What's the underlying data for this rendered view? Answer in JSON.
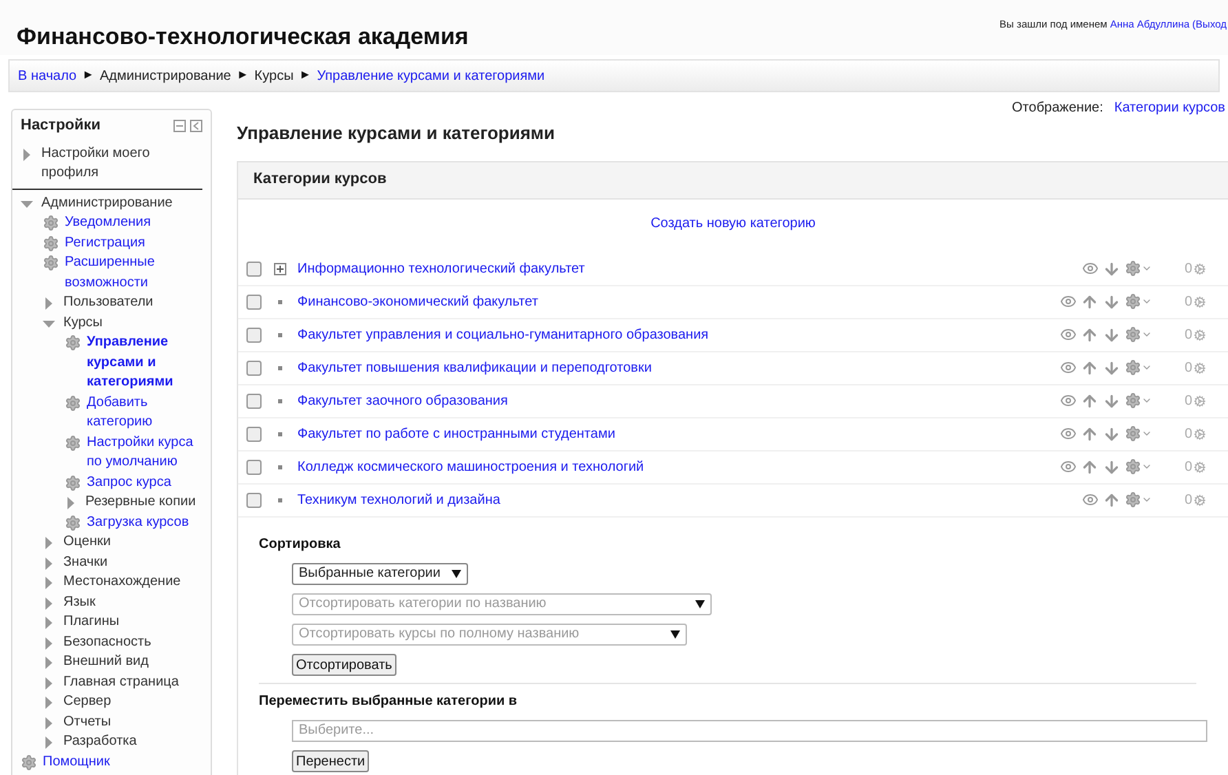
{
  "site": {
    "title": "Финансово-технологическая академия",
    "login": {
      "prefix": "Вы зашли под именем",
      "user": "Анна Абдуллина",
      "logout": "(Выход"
    }
  },
  "breadcrumb": [
    {
      "label": "В начало",
      "kind": "link"
    },
    {
      "label": "►",
      "kind": "separator"
    },
    {
      "label": "Администрирование",
      "kind": "text"
    },
    {
      "label": "►",
      "kind": "separator"
    },
    {
      "label": "Курсы",
      "kind": "text"
    },
    {
      "label": "►",
      "kind": "separator"
    },
    {
      "label": "Управление курсами и категориями",
      "kind": "link"
    }
  ],
  "sidebar": {
    "title": "Настройки",
    "items": [
      {
        "kind": "branch",
        "label": "Настройки моего профиля",
        "expanded": false
      },
      {
        "kind": "divider"
      },
      {
        "kind": "branch",
        "label": "Администрирование",
        "expanded": true,
        "children": [
          {
            "kind": "leaf",
            "label": "Уведомления",
            "selected": false
          },
          {
            "kind": "leaf",
            "label": "Регистрация",
            "selected": false
          },
          {
            "kind": "leaf",
            "label": "Расширенные возможности",
            "selected": false
          },
          {
            "kind": "branch",
            "label": "Пользователи",
            "expanded": false
          },
          {
            "kind": "branch",
            "label": "Курсы",
            "expanded": true,
            "children": [
              {
                "kind": "leaf",
                "label": "Управление курсами и категориями",
                "selected": true
              },
              {
                "kind": "leaf",
                "label": "Добавить категорию",
                "selected": false
              },
              {
                "kind": "leaf",
                "label": "Настройки курса по умолчанию",
                "selected": false
              },
              {
                "kind": "leaf",
                "label": "Запрос курса",
                "selected": false
              },
              {
                "kind": "branch",
                "label": "Резервные копии",
                "expanded": false
              },
              {
                "kind": "leaf",
                "label": "Загрузка курсов",
                "selected": false
              }
            ]
          },
          {
            "kind": "branch",
            "label": "Оценки",
            "expanded": false
          },
          {
            "kind": "branch",
            "label": "Значки",
            "expanded": false
          },
          {
            "kind": "branch",
            "label": "Местонахождение",
            "expanded": false
          },
          {
            "kind": "branch",
            "label": "Язык",
            "expanded": false
          },
          {
            "kind": "branch",
            "label": "Плагины",
            "expanded": false
          },
          {
            "kind": "branch",
            "label": "Безопасность",
            "expanded": false
          },
          {
            "kind": "branch",
            "label": "Внешний вид",
            "expanded": false
          },
          {
            "kind": "branch",
            "label": "Главная страница",
            "expanded": false
          },
          {
            "kind": "branch",
            "label": "Сервер",
            "expanded": false
          },
          {
            "kind": "branch",
            "label": "Отчеты",
            "expanded": false
          },
          {
            "kind": "branch",
            "label": "Разработка",
            "expanded": false
          }
        ]
      },
      {
        "kind": "leaf",
        "label": "Помощник",
        "selected": false
      }
    ]
  },
  "main": {
    "heading": "Управление курсами и категориями",
    "view_label": "Отображение:",
    "view_value": "Категории курсов",
    "panel_title": "Категории курсов",
    "create_link": "Создать новую категорию",
    "categories": [
      {
        "name": "Информационно технологический факультет",
        "kind": "expandable",
        "checked": false,
        "can_move_up": false,
        "can_move_down": true,
        "count": "0"
      },
      {
        "name": "Финансово-экономический факультет",
        "kind": "leaf",
        "checked": false,
        "can_move_up": true,
        "can_move_down": true,
        "count": "0"
      },
      {
        "name": "Факультет управления и социально-гуманитарного образования",
        "kind": "leaf",
        "checked": false,
        "can_move_up": true,
        "can_move_down": true,
        "count": "0"
      },
      {
        "name": "Факультет повышения квалификации и переподготовки",
        "kind": "leaf",
        "checked": false,
        "can_move_up": true,
        "can_move_down": true,
        "count": "0"
      },
      {
        "name": "Факультет заочного образования",
        "kind": "leaf",
        "checked": false,
        "can_move_up": true,
        "can_move_down": true,
        "count": "0"
      },
      {
        "name": "Факультет по работе с иностранными студентами",
        "kind": "leaf",
        "checked": false,
        "can_move_up": true,
        "can_move_down": true,
        "count": "0"
      },
      {
        "name": "Колледж космического машиностроения и технологий",
        "kind": "leaf",
        "checked": false,
        "can_move_up": true,
        "can_move_down": true,
        "count": "0"
      },
      {
        "name": "Техникум технологий и дизайна",
        "kind": "leaf",
        "checked": false,
        "can_move_up": true,
        "can_move_down": false,
        "count": "0"
      }
    ],
    "sort": {
      "title": "Сортировка",
      "selects": [
        {
          "value": "Выбранные категории",
          "disabled": false
        },
        {
          "value": "Отсортировать категории по названию",
          "disabled": true
        },
        {
          "value": "Отсортировать курсы по полному названию",
          "disabled": true
        }
      ],
      "button": "Отсортировать"
    },
    "move": {
      "title": "Переместить выбранные категории в",
      "placeholder": "Выберите...",
      "button": "Перенести"
    }
  }
}
